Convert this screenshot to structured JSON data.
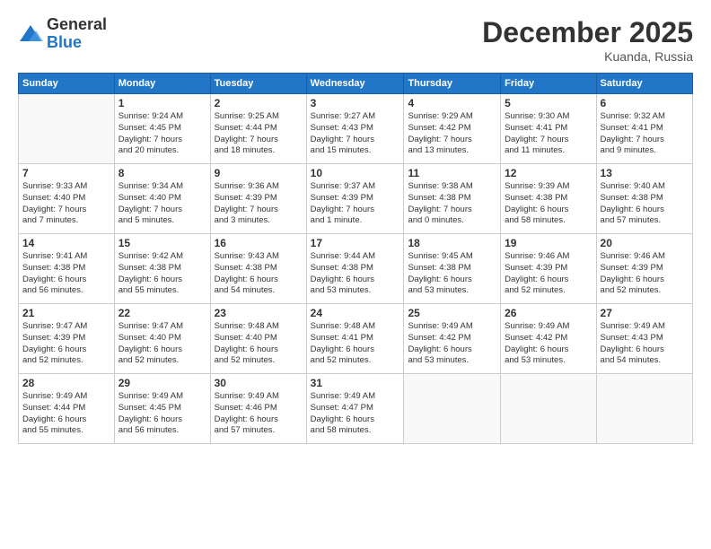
{
  "logo": {
    "general": "General",
    "blue": "Blue"
  },
  "title": "December 2025",
  "location": "Kuanda, Russia",
  "days_header": [
    "Sunday",
    "Monday",
    "Tuesday",
    "Wednesday",
    "Thursday",
    "Friday",
    "Saturday"
  ],
  "weeks": [
    [
      {
        "day": "",
        "info": ""
      },
      {
        "day": "1",
        "info": "Sunrise: 9:24 AM\nSunset: 4:45 PM\nDaylight: 7 hours\nand 20 minutes."
      },
      {
        "day": "2",
        "info": "Sunrise: 9:25 AM\nSunset: 4:44 PM\nDaylight: 7 hours\nand 18 minutes."
      },
      {
        "day": "3",
        "info": "Sunrise: 9:27 AM\nSunset: 4:43 PM\nDaylight: 7 hours\nand 15 minutes."
      },
      {
        "day": "4",
        "info": "Sunrise: 9:29 AM\nSunset: 4:42 PM\nDaylight: 7 hours\nand 13 minutes."
      },
      {
        "day": "5",
        "info": "Sunrise: 9:30 AM\nSunset: 4:41 PM\nDaylight: 7 hours\nand 11 minutes."
      },
      {
        "day": "6",
        "info": "Sunrise: 9:32 AM\nSunset: 4:41 PM\nDaylight: 7 hours\nand 9 minutes."
      }
    ],
    [
      {
        "day": "7",
        "info": "Sunrise: 9:33 AM\nSunset: 4:40 PM\nDaylight: 7 hours\nand 7 minutes."
      },
      {
        "day": "8",
        "info": "Sunrise: 9:34 AM\nSunset: 4:40 PM\nDaylight: 7 hours\nand 5 minutes."
      },
      {
        "day": "9",
        "info": "Sunrise: 9:36 AM\nSunset: 4:39 PM\nDaylight: 7 hours\nand 3 minutes."
      },
      {
        "day": "10",
        "info": "Sunrise: 9:37 AM\nSunset: 4:39 PM\nDaylight: 7 hours\nand 1 minute."
      },
      {
        "day": "11",
        "info": "Sunrise: 9:38 AM\nSunset: 4:38 PM\nDaylight: 7 hours\nand 0 minutes."
      },
      {
        "day": "12",
        "info": "Sunrise: 9:39 AM\nSunset: 4:38 PM\nDaylight: 6 hours\nand 58 minutes."
      },
      {
        "day": "13",
        "info": "Sunrise: 9:40 AM\nSunset: 4:38 PM\nDaylight: 6 hours\nand 57 minutes."
      }
    ],
    [
      {
        "day": "14",
        "info": "Sunrise: 9:41 AM\nSunset: 4:38 PM\nDaylight: 6 hours\nand 56 minutes."
      },
      {
        "day": "15",
        "info": "Sunrise: 9:42 AM\nSunset: 4:38 PM\nDaylight: 6 hours\nand 55 minutes."
      },
      {
        "day": "16",
        "info": "Sunrise: 9:43 AM\nSunset: 4:38 PM\nDaylight: 6 hours\nand 54 minutes."
      },
      {
        "day": "17",
        "info": "Sunrise: 9:44 AM\nSunset: 4:38 PM\nDaylight: 6 hours\nand 53 minutes."
      },
      {
        "day": "18",
        "info": "Sunrise: 9:45 AM\nSunset: 4:38 PM\nDaylight: 6 hours\nand 53 minutes."
      },
      {
        "day": "19",
        "info": "Sunrise: 9:46 AM\nSunset: 4:39 PM\nDaylight: 6 hours\nand 52 minutes."
      },
      {
        "day": "20",
        "info": "Sunrise: 9:46 AM\nSunset: 4:39 PM\nDaylight: 6 hours\nand 52 minutes."
      }
    ],
    [
      {
        "day": "21",
        "info": "Sunrise: 9:47 AM\nSunset: 4:39 PM\nDaylight: 6 hours\nand 52 minutes."
      },
      {
        "day": "22",
        "info": "Sunrise: 9:47 AM\nSunset: 4:40 PM\nDaylight: 6 hours\nand 52 minutes."
      },
      {
        "day": "23",
        "info": "Sunrise: 9:48 AM\nSunset: 4:40 PM\nDaylight: 6 hours\nand 52 minutes."
      },
      {
        "day": "24",
        "info": "Sunrise: 9:48 AM\nSunset: 4:41 PM\nDaylight: 6 hours\nand 52 minutes."
      },
      {
        "day": "25",
        "info": "Sunrise: 9:49 AM\nSunset: 4:42 PM\nDaylight: 6 hours\nand 53 minutes."
      },
      {
        "day": "26",
        "info": "Sunrise: 9:49 AM\nSunset: 4:42 PM\nDaylight: 6 hours\nand 53 minutes."
      },
      {
        "day": "27",
        "info": "Sunrise: 9:49 AM\nSunset: 4:43 PM\nDaylight: 6 hours\nand 54 minutes."
      }
    ],
    [
      {
        "day": "28",
        "info": "Sunrise: 9:49 AM\nSunset: 4:44 PM\nDaylight: 6 hours\nand 55 minutes."
      },
      {
        "day": "29",
        "info": "Sunrise: 9:49 AM\nSunset: 4:45 PM\nDaylight: 6 hours\nand 56 minutes."
      },
      {
        "day": "30",
        "info": "Sunrise: 9:49 AM\nSunset: 4:46 PM\nDaylight: 6 hours\nand 57 minutes."
      },
      {
        "day": "31",
        "info": "Sunrise: 9:49 AM\nSunset: 4:47 PM\nDaylight: 6 hours\nand 58 minutes."
      },
      {
        "day": "",
        "info": ""
      },
      {
        "day": "",
        "info": ""
      },
      {
        "day": "",
        "info": ""
      }
    ]
  ]
}
